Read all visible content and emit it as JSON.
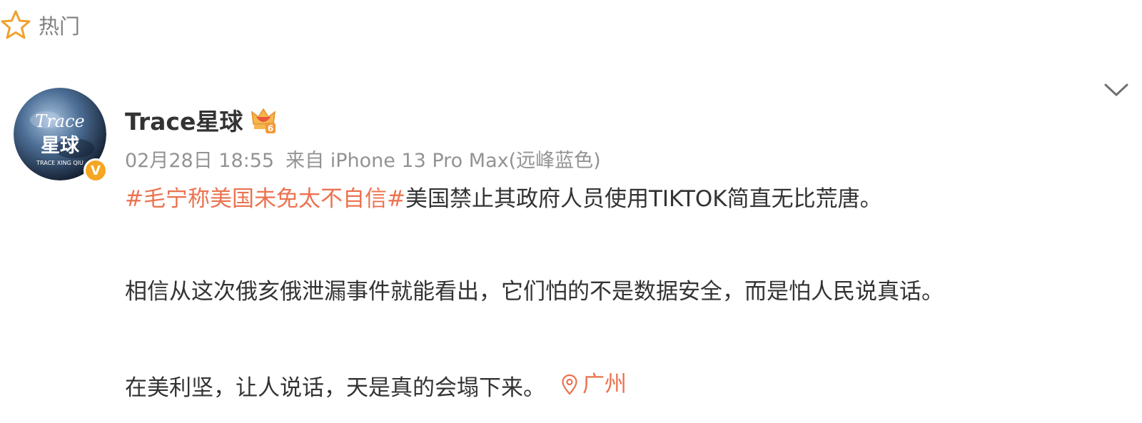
{
  "header": {
    "label": "热门",
    "icon": "star-outline-icon",
    "icon_color": "#f0a030"
  },
  "post": {
    "avatar": {
      "icon": "avatar-trace-planet",
      "line1": "Trace",
      "line2": "星球",
      "line3": "TRACE XING QIU"
    },
    "verified_badge": "V",
    "username": "Trace星球",
    "member_level": "6",
    "date": "02月28日 18:55",
    "source_prefix": "来自",
    "device": "iPhone 13 Pro Max(远峰蓝色)",
    "hashtag": "#毛宁称美国未免太不自信#",
    "text_line1": "美国禁止其政府人员使用TIKTOK简直无比荒唐。",
    "text_line2": "相信从这次俄亥俄泄漏事件就能看出，它们怕的不是数据安全，而是怕人民说真话。",
    "text_line3": "在美利坚，让人说话，天是真的会塌下来。",
    "location": "广州"
  },
  "colors": {
    "accent": "#eb7350",
    "text": "#333333",
    "meta": "#939393",
    "badge": "#f5a623"
  }
}
